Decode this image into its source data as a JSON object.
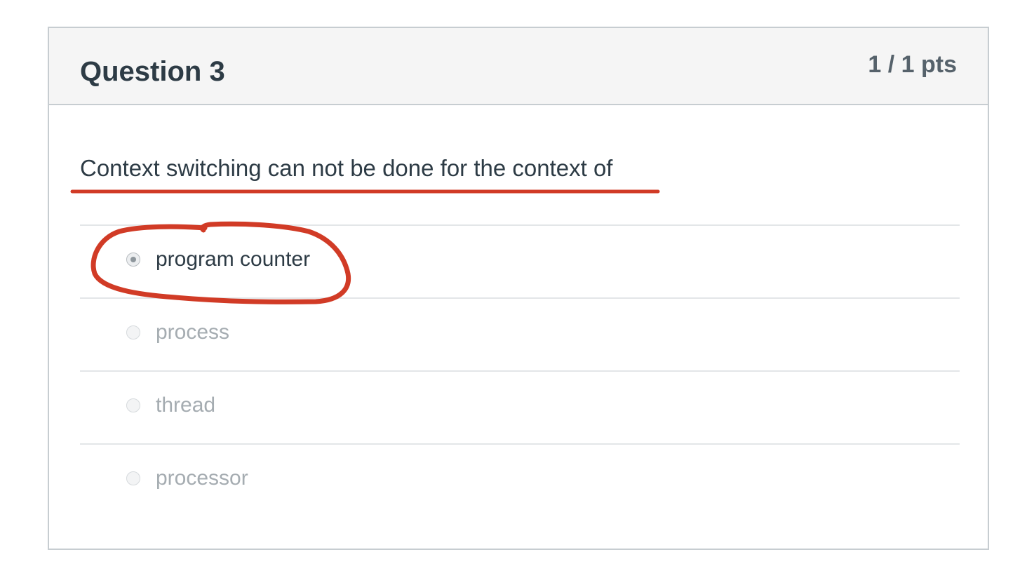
{
  "question": {
    "title": "Question 3",
    "points": "1 / 1 pts",
    "text": "Context switching can not be done for the context of"
  },
  "answers": [
    {
      "label": "program counter",
      "selected": true
    },
    {
      "label": "process",
      "selected": false
    },
    {
      "label": "thread",
      "selected": false
    },
    {
      "label": "processor",
      "selected": false
    }
  ],
  "colors": {
    "annotation": "#d13b26",
    "text_primary": "#2d3b45",
    "text_muted": "#a5acb1",
    "header_bg": "#f5f5f5",
    "border": "#c7cdd1"
  }
}
